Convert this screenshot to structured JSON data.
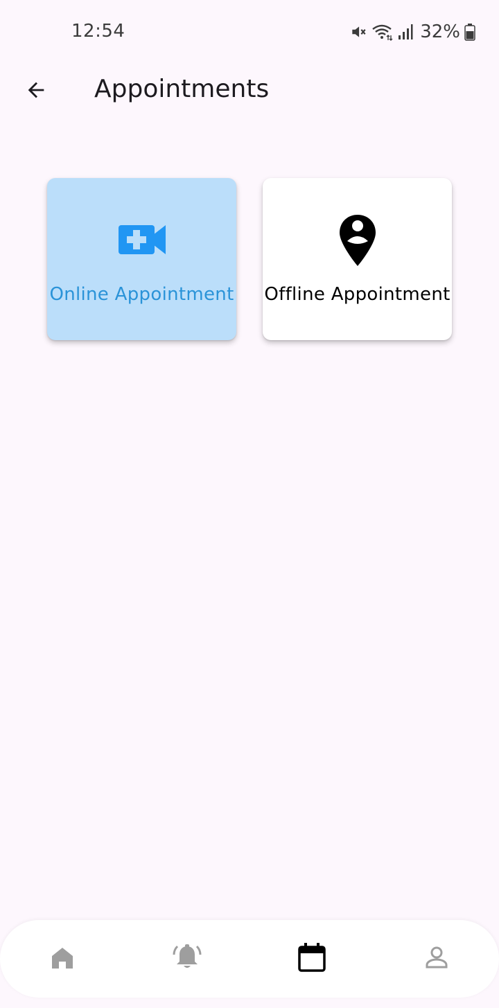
{
  "status_bar": {
    "time": "12:54",
    "battery": "32%",
    "icons": [
      "mute-icon",
      "wifi-icon",
      "signal-icon",
      "battery-icon"
    ]
  },
  "header": {
    "title": "Appointments",
    "back_icon": "arrow-back-icon"
  },
  "cards": [
    {
      "label": "Online Appointment",
      "icon": "video-call-icon",
      "selected": true
    },
    {
      "label": "Offline Appointment",
      "icon": "person-pin-icon",
      "selected": false
    }
  ],
  "bottom_nav": {
    "items": [
      {
        "icon": "home-icon",
        "active": false
      },
      {
        "icon": "notification-bell-icon",
        "active": false
      },
      {
        "icon": "calendar-icon",
        "active": true
      },
      {
        "icon": "person-icon",
        "active": false
      }
    ]
  },
  "colors": {
    "background": "#fdf7fd",
    "selected_card": "#bbdefa",
    "accent_blue": "#2196f3",
    "selected_text": "#2a93d8",
    "inactive_nav_icon": "#9e9e9e",
    "active_nav_icon": "#000000"
  }
}
